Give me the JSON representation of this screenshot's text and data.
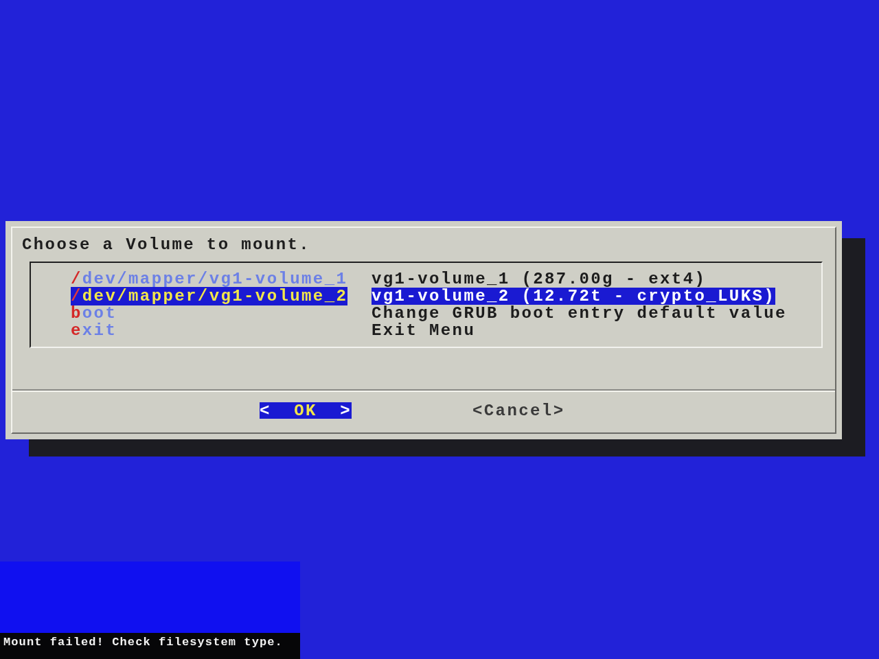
{
  "dialog": {
    "prompt": "Choose a Volume to mount.",
    "menu_items": [
      {
        "tag": "/dev/mapper/vg1-volume_1",
        "description": "vg1-volume_1 (287.00g - ext4)",
        "selected": false
      },
      {
        "tag": "/dev/mapper/vg1-volume_2",
        "description": "vg1-volume_2 (12.72t - crypto_LUKS)",
        "selected": true
      },
      {
        "tag": "boot",
        "description": "Change GRUB boot entry default value",
        "selected": false
      },
      {
        "tag": "exit",
        "description": "Exit Menu",
        "selected": false
      }
    ],
    "buttons": [
      {
        "open": "<",
        "label": "OK",
        "close": ">",
        "selected": true
      },
      {
        "open": "<",
        "label": "Cancel",
        "close": ">",
        "selected": false
      }
    ]
  },
  "console": {
    "message": "Mount failed! Check filesystem type."
  }
}
